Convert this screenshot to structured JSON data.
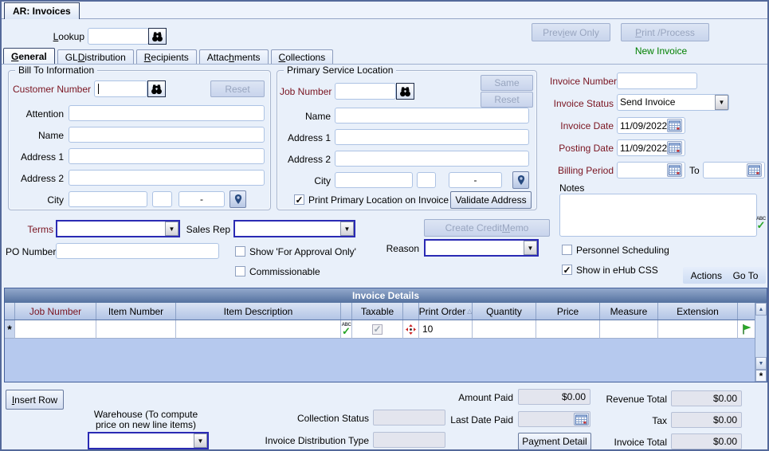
{
  "window": {
    "tab_title": "AR: Invoices"
  },
  "colors": {
    "required_label": "#7a1420",
    "status_green": "#008000",
    "combo_border": "#2a2ab4",
    "table_title_blue": "#5b76a4",
    "grid_background": "#b6c9ee"
  },
  "toolbar": {
    "lookup_label": "Lookup",
    "lookup_accel": "L",
    "lookup_value": "",
    "preview_button": "Preview Only",
    "preview_accel": "i",
    "print_button": "Print /Process",
    "print_accel": "P",
    "status_message": "New Invoice"
  },
  "tabs": [
    {
      "label": "General",
      "accel": "G"
    },
    {
      "label": "GL Distribution",
      "accel": "D"
    },
    {
      "label": "Recipients",
      "accel": "R"
    },
    {
      "label": "Attachments",
      "accel": "h"
    },
    {
      "label": "Collections",
      "accel": "C"
    }
  ],
  "bill_to": {
    "title": "Bill To Information",
    "customer_number_label": "Customer Number",
    "customer_number_value": "",
    "reset_button": "Reset",
    "attention_label": "Attention",
    "attention_value": "",
    "name_label": "Name",
    "name_value": "",
    "address1_label": "Address 1",
    "address1_value": "",
    "address2_label": "Address 2",
    "address2_value": "",
    "city_label": "City",
    "city_value": "",
    "state_value": "",
    "zip_mask": "-"
  },
  "service_location": {
    "title": "Primary Service Location",
    "job_number_label": "Job Number",
    "job_number_value": "",
    "same_button": "Same",
    "reset_button": "Reset",
    "name_label": "Name",
    "name_value": "",
    "address1_label": "Address 1",
    "address1_value": "",
    "address2_label": "Address 2",
    "address2_value": "",
    "city_label": "City",
    "city_value": "",
    "state_value": "",
    "zip_mask": "-",
    "print_primary_label": "Print Primary Location on Invoice",
    "print_primary_checked": true,
    "validate_address_button": "Validate Address"
  },
  "invoice_info": {
    "invoice_number_label": "Invoice Number",
    "invoice_number_value": "",
    "invoice_status_label": "Invoice Status",
    "invoice_status_value": "Send Invoice",
    "invoice_date_label": "Invoice Date",
    "invoice_date_value": "11/09/2022",
    "posting_date_label": "Posting Date",
    "posting_date_value": "11/09/2022",
    "billing_period_label": "Billing Period",
    "billing_period_from_value": "",
    "to_label": "To",
    "billing_period_to_value": "",
    "notes_label": "Notes",
    "notes_value": "",
    "personnel_scheduling_label": "Personnel Scheduling",
    "personnel_scheduling_checked": false,
    "show_ehub_label": "Show in eHub CSS",
    "show_ehub_checked": true
  },
  "options_row": {
    "terms_label": "Terms",
    "terms_value": "",
    "sales_rep_label": "Sales Rep",
    "sales_rep_value": "",
    "po_number_label": "PO Number",
    "po_number_value": "",
    "show_approval_label": "Show 'For Approval Only'",
    "show_approval_checked": false,
    "commissionable_label": "Commissionable",
    "commissionable_checked": false,
    "create_credit_memo_button": "Create Credit Memo",
    "create_credit_memo_accel": "M",
    "reason_label": "Reason",
    "reason_value": ""
  },
  "actions_bar": {
    "actions_label": "Actions",
    "goto_label": "Go To"
  },
  "invoice_details": {
    "title": "Invoice Details",
    "columns": [
      "Job Number",
      "Item Number",
      "Item Description",
      "Taxable",
      "Print Order",
      "Quantity",
      "Price",
      "Measure",
      "Extension"
    ],
    "sorted_column": "Print Order",
    "new_row": {
      "job_number": "",
      "item_number": "",
      "item_description": "",
      "taxable_checked": true,
      "print_order": "10",
      "quantity": "",
      "price": "",
      "measure": "",
      "extension": ""
    }
  },
  "footer": {
    "insert_row_button": "Insert Row",
    "insert_row_accel": "I",
    "warehouse_label": "Warehouse (To compute price on new line items)",
    "warehouse_value": "",
    "collection_status_label": "Collection Status",
    "collection_status_value": "",
    "invoice_distribution_type_label": "Invoice Distribution Type",
    "invoice_distribution_type_value": "",
    "amount_paid_label": "Amount Paid",
    "amount_paid_value": "$0.00",
    "last_date_paid_label": "Last Date Paid",
    "last_date_paid_value": "",
    "payment_detail_button": "Payment Detail",
    "payment_detail_accel": "y",
    "revenue_total_label": "Revenue Total",
    "revenue_total_value": "$0.00",
    "tax_label": "Tax",
    "tax_value": "$0.00",
    "invoice_total_label": "Invoice Total",
    "invoice_total_value": "$0.00"
  }
}
